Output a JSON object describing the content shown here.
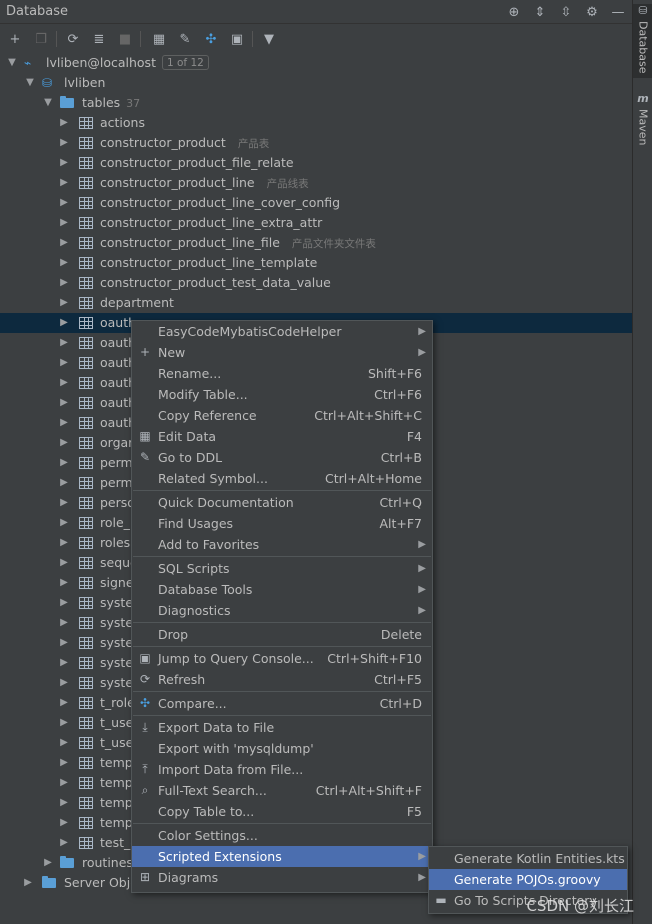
{
  "header": {
    "title": "Database"
  },
  "right_tabs": [
    {
      "label": "Database",
      "icon": "database-icon"
    },
    {
      "label": "Maven",
      "icon": "maven-icon"
    }
  ],
  "tree": {
    "connection": {
      "label": "lvliben@localhost",
      "badge": "1 of 12"
    },
    "schema": {
      "label": "lvliben"
    },
    "tables_folder": {
      "label": "tables",
      "count": "37"
    },
    "tables": [
      {
        "name": "actions",
        "comment": ""
      },
      {
        "name": "constructor_product",
        "comment": "产品表"
      },
      {
        "name": "constructor_product_file_relate",
        "comment": ""
      },
      {
        "name": "constructor_product_line",
        "comment": "产品线表"
      },
      {
        "name": "constructor_product_line_cover_config",
        "comment": ""
      },
      {
        "name": "constructor_product_line_extra_attr",
        "comment": ""
      },
      {
        "name": "constructor_product_line_file",
        "comment": "产品文件夹文件表"
      },
      {
        "name": "constructor_product_line_template",
        "comment": ""
      },
      {
        "name": "constructor_product_test_data_value",
        "comment": ""
      },
      {
        "name": "department",
        "comment": ""
      },
      {
        "name": "oauth",
        "comment": ""
      },
      {
        "name": "oauth",
        "comment": ""
      },
      {
        "name": "oauth",
        "comment": ""
      },
      {
        "name": "oauth",
        "comment": ""
      },
      {
        "name": "oauth",
        "comment": ""
      },
      {
        "name": "oauth",
        "comment": ""
      },
      {
        "name": "orgar",
        "comment": ""
      },
      {
        "name": "permi",
        "comment": ""
      },
      {
        "name": "permi",
        "comment": ""
      },
      {
        "name": "perso",
        "comment": ""
      },
      {
        "name": "role_h",
        "comment": ""
      },
      {
        "name": "roles",
        "comment": ""
      },
      {
        "name": "seque",
        "comment": ""
      },
      {
        "name": "signet",
        "comment": ""
      },
      {
        "name": "syster",
        "comment": ""
      },
      {
        "name": "syster",
        "comment": ""
      },
      {
        "name": "syster",
        "comment": ""
      },
      {
        "name": "syster",
        "comment": ""
      },
      {
        "name": "syster",
        "comment": ""
      },
      {
        "name": "t_role",
        "comment": ""
      },
      {
        "name": "t_user",
        "comment": ""
      },
      {
        "name": "t_user",
        "comment": ""
      },
      {
        "name": "templ",
        "comment": ""
      },
      {
        "name": "templ",
        "comment": ""
      },
      {
        "name": "templ",
        "comment": ""
      },
      {
        "name": "templ",
        "comment": ""
      },
      {
        "name": "test_d",
        "comment": ""
      }
    ],
    "routines": {
      "label": "routines"
    },
    "server_objects": {
      "label": "Server Obje"
    }
  },
  "context_menu": {
    "items": [
      {
        "label": "EasyCodeMybatisCodeHelper",
        "shortcut": "",
        "submenu": true,
        "icon": ""
      },
      {
        "label": "New",
        "shortcut": "",
        "submenu": true,
        "icon": "plus-icon"
      },
      {
        "label": "Rename...",
        "shortcut": "Shift+F6",
        "submenu": false,
        "icon": ""
      },
      {
        "label": "Modify Table...",
        "shortcut": "Ctrl+F6",
        "submenu": false,
        "icon": ""
      },
      {
        "label": "Copy Reference",
        "shortcut": "Ctrl+Alt+Shift+C",
        "submenu": false,
        "icon": ""
      },
      {
        "label": "Edit Data",
        "shortcut": "F4",
        "submenu": false,
        "icon": "table-icon"
      },
      {
        "label": "Go to DDL",
        "shortcut": "Ctrl+B",
        "submenu": false,
        "icon": "pencil-icon"
      },
      {
        "label": "Related Symbol...",
        "shortcut": "Ctrl+Alt+Home",
        "submenu": false,
        "icon": ""
      },
      {
        "label": "Quick Documentation",
        "shortcut": "Ctrl+Q",
        "submenu": false,
        "icon": ""
      },
      {
        "label": "Find Usages",
        "shortcut": "Alt+F7",
        "submenu": false,
        "icon": ""
      },
      {
        "label": "Add to Favorites",
        "shortcut": "",
        "submenu": true,
        "icon": ""
      },
      {
        "label": "SQL Scripts",
        "shortcut": "",
        "submenu": true,
        "icon": ""
      },
      {
        "label": "Database Tools",
        "shortcut": "",
        "submenu": true,
        "icon": ""
      },
      {
        "label": "Diagnostics",
        "shortcut": "",
        "submenu": true,
        "icon": ""
      },
      {
        "label": "Drop",
        "shortcut": "Delete",
        "submenu": false,
        "icon": ""
      },
      {
        "label": "Jump to Query Console...",
        "shortcut": "Ctrl+Shift+F10",
        "submenu": false,
        "icon": "ql-console-icon"
      },
      {
        "label": "Refresh",
        "shortcut": "Ctrl+F5",
        "submenu": false,
        "icon": "refresh-icon"
      },
      {
        "label": "Compare...",
        "shortcut": "Ctrl+D",
        "submenu": false,
        "icon": "compare-icon"
      },
      {
        "label": "Export Data to File",
        "shortcut": "",
        "submenu": false,
        "icon": "export-icon"
      },
      {
        "label": "Export with 'mysqldump'",
        "shortcut": "",
        "submenu": false,
        "icon": ""
      },
      {
        "label": "Import Data from File...",
        "shortcut": "",
        "submenu": false,
        "icon": "import-icon"
      },
      {
        "label": "Full-Text Search...",
        "shortcut": "Ctrl+Alt+Shift+F",
        "submenu": false,
        "icon": "search-icon"
      },
      {
        "label": "Copy Table to...",
        "shortcut": "F5",
        "submenu": false,
        "icon": ""
      },
      {
        "label": "Color Settings...",
        "shortcut": "",
        "submenu": false,
        "icon": ""
      },
      {
        "label": "Scripted Extensions",
        "shortcut": "",
        "submenu": true,
        "icon": ""
      },
      {
        "label": "Diagrams",
        "shortcut": "",
        "submenu": true,
        "icon": "diagram-icon"
      }
    ]
  },
  "submenu": {
    "items": [
      {
        "label": "Generate Kotlin Entities.kts",
        "icon": ""
      },
      {
        "label": "Generate POJOs.groovy",
        "icon": ""
      },
      {
        "label": "Go To Scripts Directory",
        "icon": "folder-icon"
      }
    ]
  },
  "watermark": "CSDN @刘长江",
  "colors": {
    "background": "#3c3f41",
    "selection": "#0d293e",
    "menu_active": "#4b6eaf",
    "folder": "#5a9fd6"
  }
}
